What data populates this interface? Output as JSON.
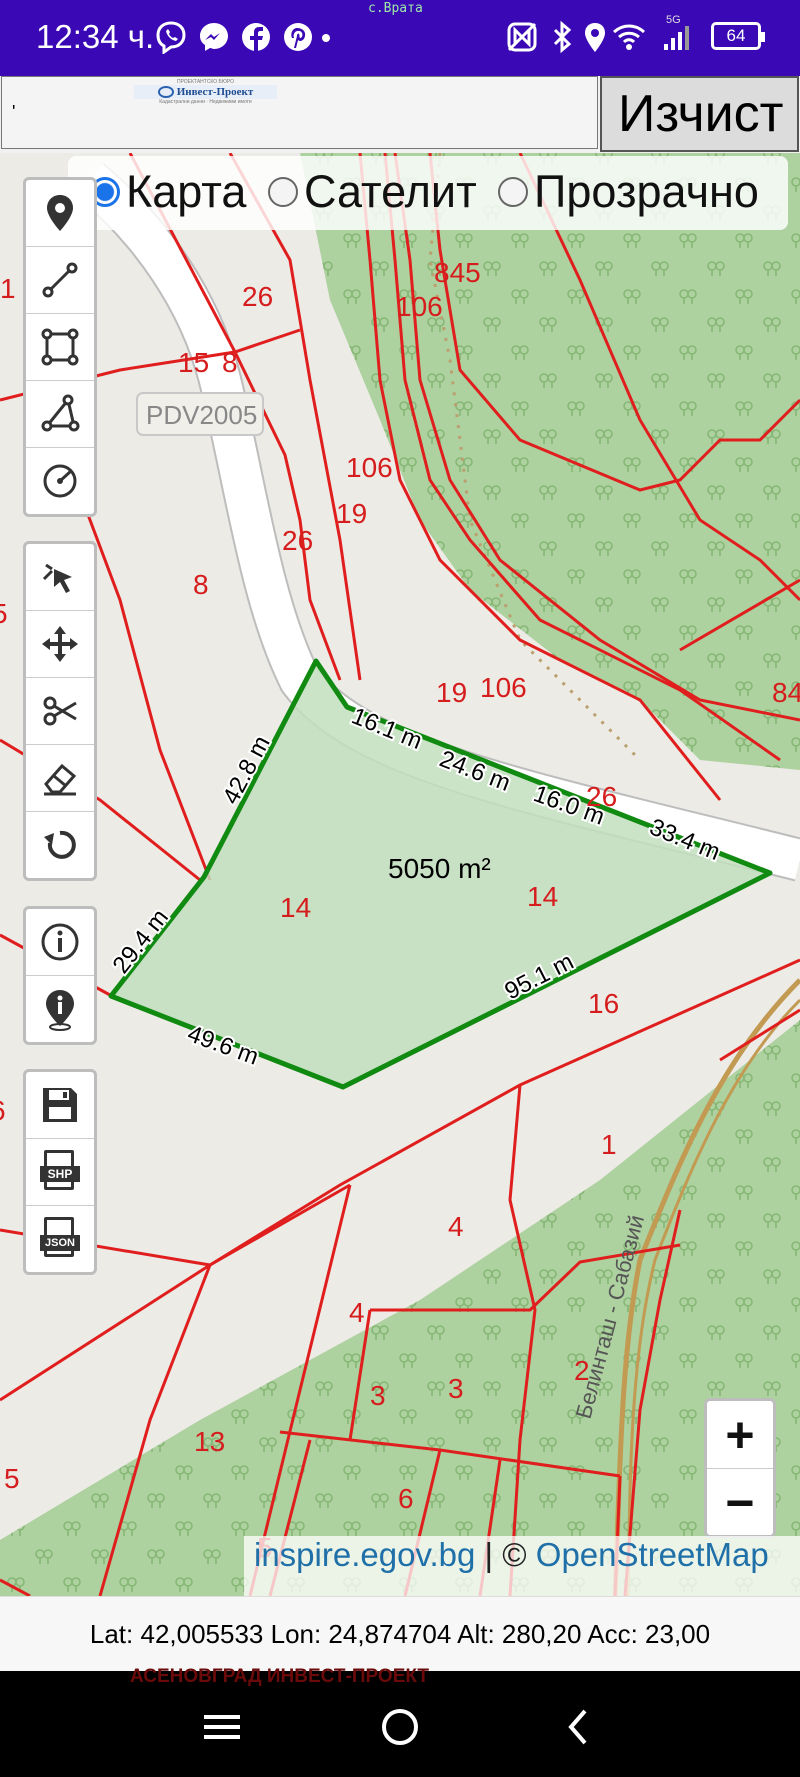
{
  "status_bar": {
    "time": "12:34 ч.",
    "tiny_label": "с.Врата",
    "network": "5G",
    "battery": "64",
    "icons": [
      "viber-icon",
      "messenger-icon",
      "facebook-icon",
      "pinterest-icon",
      "dot-icon",
      "nfc-icon",
      "bluetooth-icon",
      "location-icon",
      "wifi-icon",
      "signal-icon",
      "battery-icon"
    ]
  },
  "top_bar": {
    "address_value": "'",
    "logo_text": "Инвест-Проект",
    "logo_caption_top": "ПРОЕКТАНТСКО БЮРО",
    "logo_caption_bottom": "Кадастрални данни · Недвижими имоти",
    "clear_button": "Изчист"
  },
  "layers": {
    "options": [
      {
        "label": "Карта",
        "selected": true
      },
      {
        "label": "Сателит",
        "selected": false
      },
      {
        "label": "Прозрачно",
        "selected": false
      }
    ]
  },
  "toolbars": {
    "draw": [
      "marker-tool",
      "line-tool",
      "rectangle-tool",
      "polygon-tool",
      "circle-tool"
    ],
    "edit": [
      "select-tool",
      "move-tool",
      "cut-tool",
      "eraser-tool",
      "undo-tool"
    ],
    "info": [
      "info-tool",
      "location-info-tool"
    ],
    "export": [
      "save-tool",
      "shp-export-tool",
      "json-export-tool"
    ]
  },
  "export_labels": {
    "shp": "SHP",
    "json": "JSON"
  },
  "map": {
    "area_label": "5050 m²",
    "badge": "PDV2005",
    "road_name": "Белинташ - Сабазий",
    "segment_labels": [
      "16.1 m",
      "24.6 m",
      "16.0 m",
      "33.4 m",
      "95.1 m",
      "49.6 m",
      "29.4 m",
      "42.8 m"
    ],
    "parcel_labels": [
      "1",
      "26",
      "15",
      "8",
      "845",
      "106",
      "106",
      "19",
      "26",
      "8",
      "5",
      "19",
      "106",
      "84",
      "26",
      "14",
      "14",
      "16",
      "6",
      "1",
      "4",
      "4",
      "3",
      "3",
      "2",
      "13",
      "5",
      "6",
      "5"
    ]
  },
  "zoom": {
    "in": "+",
    "out": "−"
  },
  "attribution": {
    "source": "inspire.egov.bg",
    "separator": " | © ",
    "osm": "OpenStreetMap"
  },
  "coords": "Lat: 42,005533 Lon: 24,874704 Alt: 280,20 Acc: 23,00",
  "footer_watermark": "АСЕНОВГРАД ИНВЕСТ-ПРОЕКТ",
  "colors": {
    "status_bar": "#3a08b4",
    "parcel_lines": "#e01e1e",
    "polygon_outline": "#118a11",
    "polygon_fill": "#c2dfbe",
    "forest": "#aed1a0",
    "radio_selected": "#1a73e8"
  }
}
